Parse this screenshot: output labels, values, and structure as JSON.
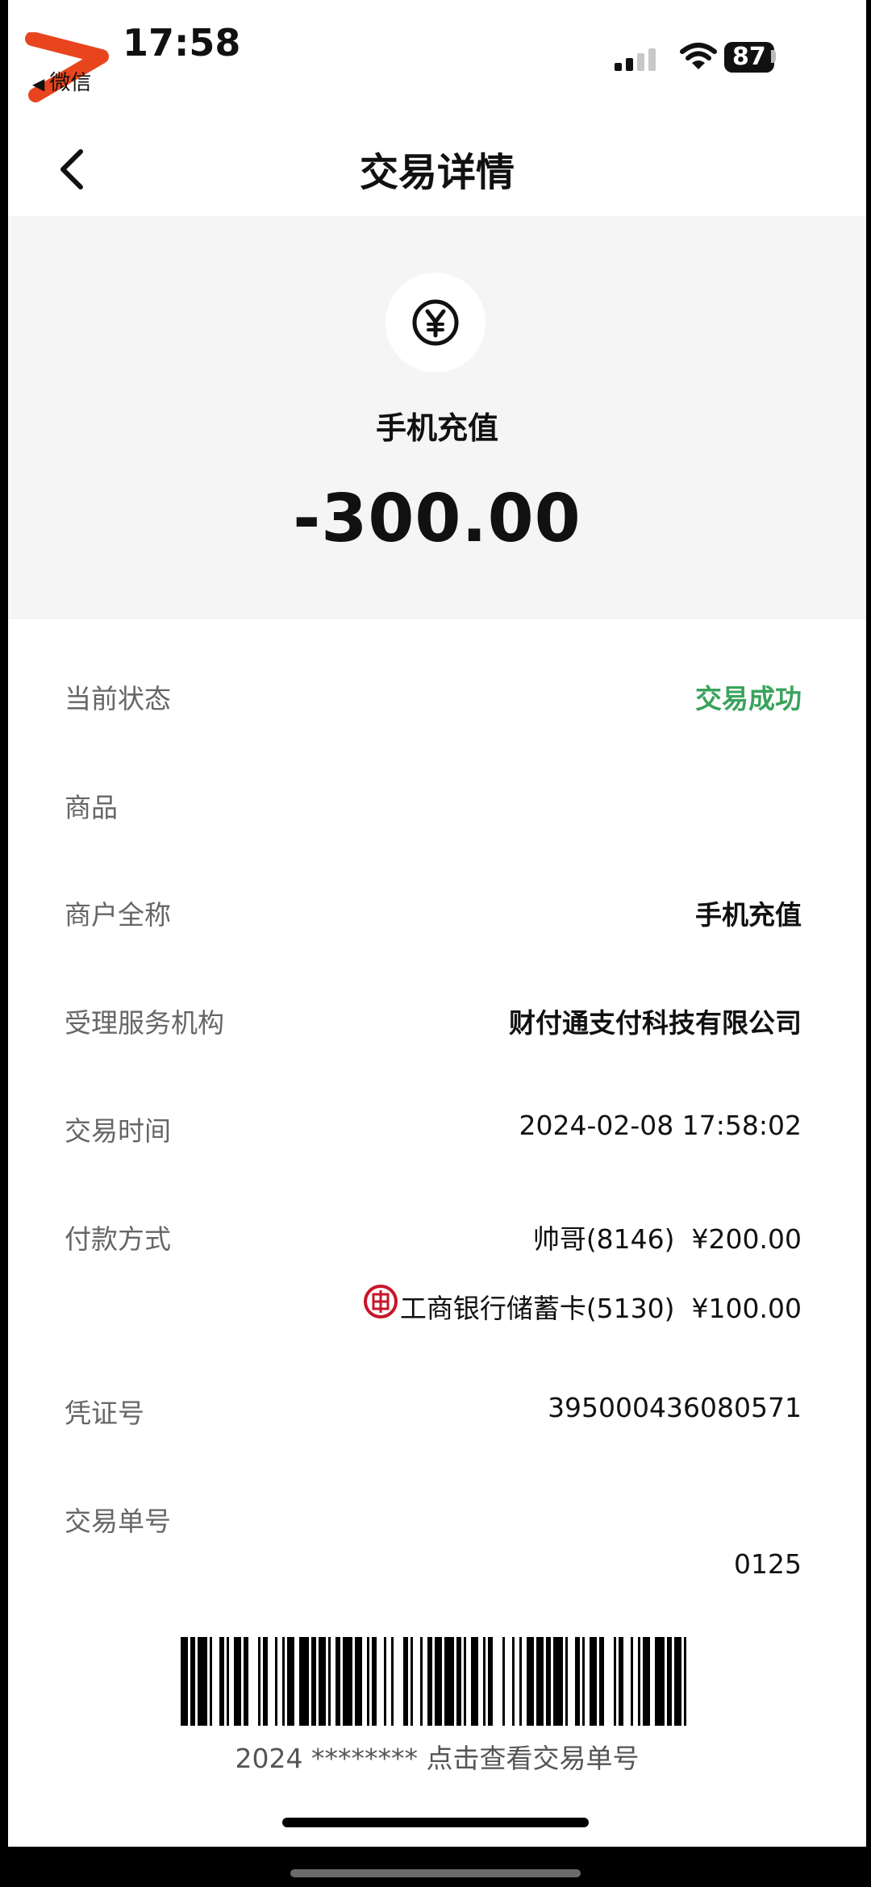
{
  "status_bar": {
    "time": "17:58",
    "back_app_label": "微信",
    "battery": "87"
  },
  "nav": {
    "title": "交易详情"
  },
  "header": {
    "icon": "yen-icon",
    "merchant": "手机充值",
    "amount": "-300.00"
  },
  "details": {
    "status_label": "当前状态",
    "status_value": "交易成功",
    "goods_label": "商品",
    "goods_value": "",
    "merchant_full_label": "商户全称",
    "merchant_full_value": "手机充值",
    "institution_label": "受理服务机构",
    "institution_value": "财付通支付科技有限公司",
    "time_label": "交易时间",
    "time_value": "2024-02-08 17:58:02",
    "payment_label": "付款方式",
    "payment_methods": [
      {
        "name": "帅哥(8146)",
        "amount": "¥200.00"
      },
      {
        "name": "工商银行储蓄卡(5130)",
        "amount": "¥100.00",
        "icon": "icbc-logo"
      }
    ],
    "voucher_label": "凭证号",
    "voucher_value": "395000436080571",
    "order_label": "交易单号",
    "order_value": "0125"
  },
  "barcode": {
    "caption": "2024 ******** 点击查看交易单号"
  },
  "colors": {
    "success": "#3aa35c",
    "header_bg": "#f5f5f5",
    "icbc_red": "#c7162b",
    "annotation": "#e8451e"
  }
}
